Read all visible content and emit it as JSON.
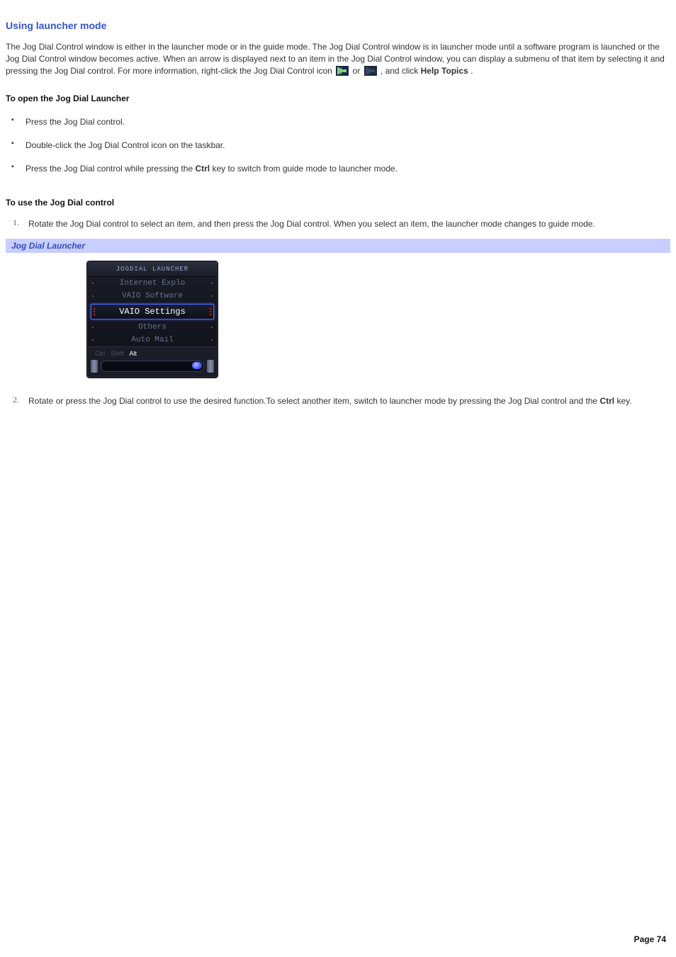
{
  "title": "Using launcher mode",
  "intro": {
    "part1": "The Jog Dial Control window is either in the launcher mode or in the guide mode. The Jog Dial Control window is in launcher mode until a software program is launched or the Jog Dial Control window becomes active. When an arrow is displayed next to an item in the Jog Dial Control window, you can display a submenu of that item by selecting it and pressing the Jog Dial control. For more information, right-click the Jog Dial Control icon ",
    "or": " or ",
    "part2": " , and click ",
    "help_topics": "Help Topics",
    "part3": "."
  },
  "sub1": "To open the Jog Dial Launcher",
  "bullets": [
    "Press the Jog Dial control.",
    "Double-click the Jog Dial Control icon on the taskbar."
  ],
  "bullet3": {
    "pre": "Press the Jog Dial control while pressing the ",
    "key": "Ctrl",
    "post": " key to switch from guide mode to launcher mode."
  },
  "sub2": "To use the Jog Dial control",
  "step1": "Rotate the Jog Dial control to select an item, and then press the Jog Dial control. When you select an item, the launcher mode changes to guide mode.",
  "caption": "Jog Dial Launcher",
  "launcher": {
    "title": "JOGDIAL LAUNCHER",
    "items_top": [
      "Internet Explo",
      "VAIO Software"
    ],
    "selected": "VAIO Settings",
    "items_bottom": [
      "Others",
      "Auto Mail"
    ],
    "modkeys": {
      "ctrl": "Ctrl",
      "shift": "Shift",
      "alt": "Alt"
    }
  },
  "step2": {
    "pre": "Rotate or press the Jog Dial control to use the desired function.To select another item, switch to launcher mode by pressing the Jog Dial control and the ",
    "key": "Ctrl",
    "post": " key."
  },
  "page_number": "Page 74"
}
